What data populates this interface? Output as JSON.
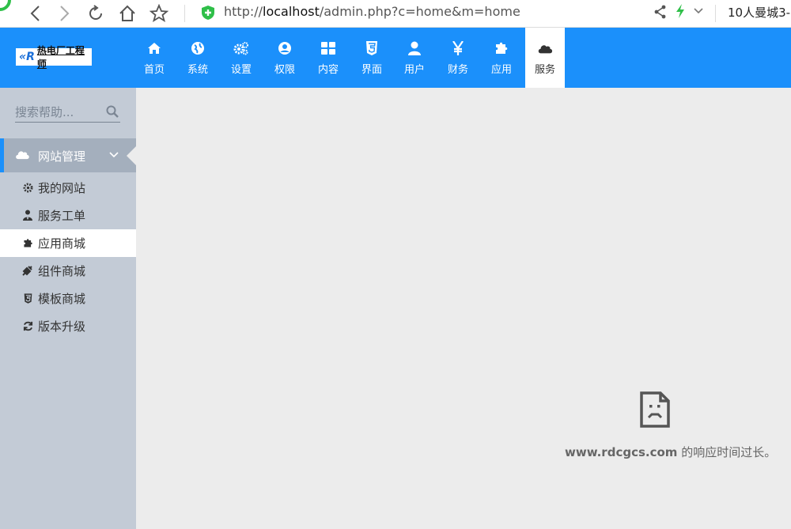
{
  "browser": {
    "url_prefix": "http://",
    "url_host": "localhost",
    "url_path": "/admin.php?c=home&m=home",
    "extension_text": "10人曼城3-"
  },
  "topnav": {
    "logo_text": "热电厂工程师",
    "items": [
      {
        "label": "首页",
        "icon": "home-icon"
      },
      {
        "label": "系统",
        "icon": "globe-icon"
      },
      {
        "label": "设置",
        "icon": "gears-icon"
      },
      {
        "label": "权限",
        "icon": "user-circle-icon"
      },
      {
        "label": "内容",
        "icon": "grid-icon"
      },
      {
        "label": "界面",
        "icon": "html5-icon"
      },
      {
        "label": "用户",
        "icon": "user-icon"
      },
      {
        "label": "财务",
        "icon": "yen-icon"
      },
      {
        "label": "应用",
        "icon": "puzzle-icon"
      },
      {
        "label": "服务",
        "icon": "cloud-icon",
        "active": true
      }
    ]
  },
  "sidebar": {
    "search_placeholder": "搜索帮助...",
    "group_label": "网站管理",
    "items": [
      {
        "label": "我的网站",
        "icon": "gear-icon"
      },
      {
        "label": "服务工单",
        "icon": "user-tie-icon"
      },
      {
        "label": "应用商城",
        "icon": "puzzle-icon",
        "active": true
      },
      {
        "label": "组件商城",
        "icon": "plug-icon"
      },
      {
        "label": "模板商城",
        "icon": "html5-icon"
      },
      {
        "label": "版本升级",
        "icon": "refresh-icon"
      }
    ]
  },
  "main": {
    "error_host": "www.rdcgcs.com",
    "error_text": " 的响应时间过长。"
  },
  "colors": {
    "nav_blue": "#1b90fb",
    "sidebar_bg": "#c3cbd6",
    "group_bg": "#a4afbd",
    "content_bg": "#ececec"
  }
}
